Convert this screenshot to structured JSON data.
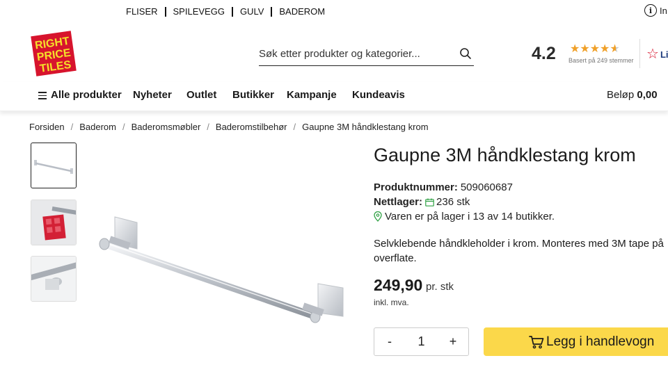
{
  "topnav": {
    "items": [
      "FLISER",
      "SPILEVEGG",
      "GULV",
      "BADEROM"
    ],
    "info_label": "In"
  },
  "logo": {
    "line1": "RIGHT",
    "line2": "PRICE",
    "line3": "TILES",
    "color_bg": "#d7142d",
    "color_text": "#f5e12a"
  },
  "search": {
    "placeholder": "Søk etter produkter og kategorier..."
  },
  "rating": {
    "score": "4.2",
    "stars": 4.2,
    "based_on": "Basert på 249 stemmer",
    "trust_label": "Li"
  },
  "mainnav": {
    "all_products": "Alle produkter",
    "items": [
      "Nyheter",
      "Outlet",
      "Butikker",
      "Kampanje",
      "Kundeavis"
    ],
    "cart_label": "Beløp",
    "cart_amount": "0,00"
  },
  "breadcrumb": [
    "Forsiden",
    "Baderom",
    "Baderomsmøbler",
    "Baderomstilbehør",
    "Gaupne 3M håndklestang krom"
  ],
  "product": {
    "title": "Gaupne 3M håndklestang krom",
    "number_label": "Produktnummer:",
    "number": "509060687",
    "stock_label": "Nettlager:",
    "stock": "236 stk",
    "store_stock": "Varen er på lager i 13 av 14 butikker.",
    "description_line1": "Selvklebende håndkleholder i krom. Monteres med 3M tape på",
    "description_line2": "overflate.",
    "price": "249,90",
    "price_unit": "pr. stk",
    "vat_note": "inkl. mva.",
    "quantity": "1",
    "minus": "-",
    "plus": "+",
    "add_to_cart": "Legg i handlevogn",
    "accent_color": "#fbd84a",
    "stock_icon_color": "#2ea043"
  }
}
